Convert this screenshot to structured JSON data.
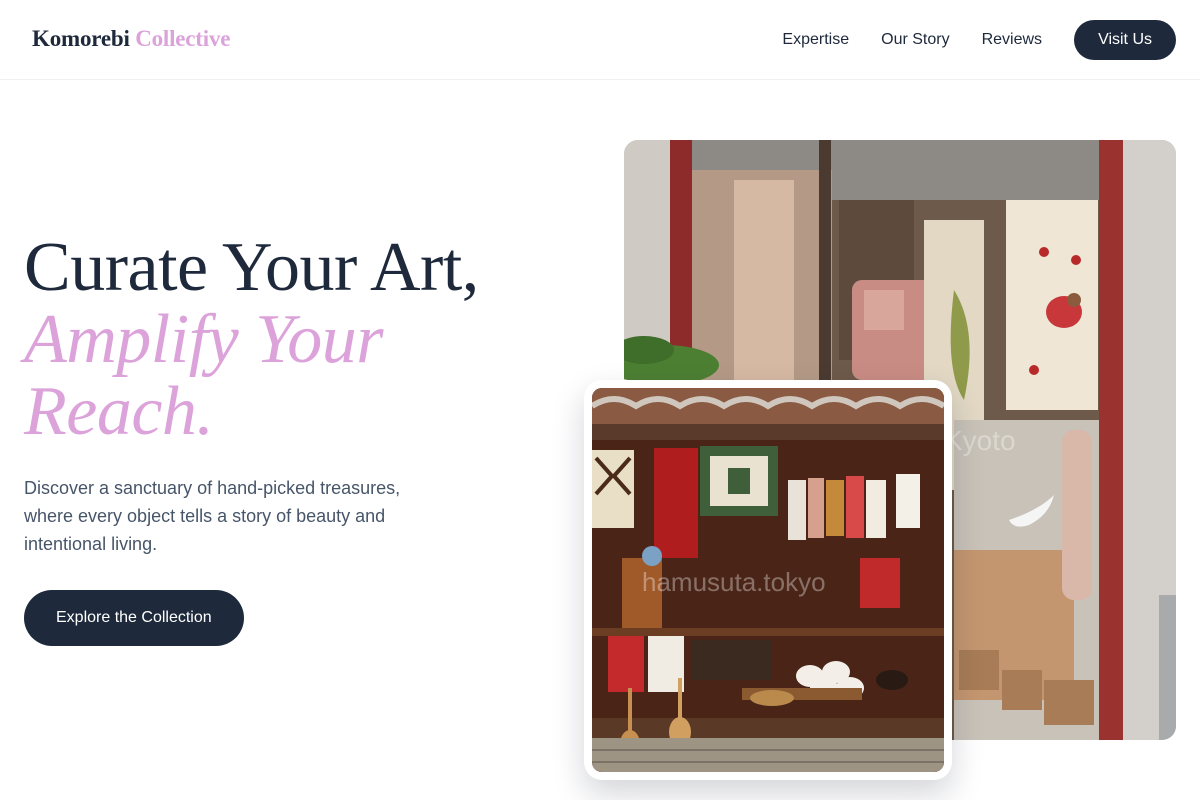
{
  "header": {
    "logo_main": "Komorebi",
    "logo_accent": "Collective",
    "nav": [
      {
        "label": "Expertise"
      },
      {
        "label": "Our Story"
      },
      {
        "label": "Reviews"
      }
    ],
    "cta_label": "Visit Us"
  },
  "hero": {
    "title_line1": "Curate Your Art,",
    "title_line2": "Amplify Your",
    "title_line3": "Reach.",
    "description": "Discover a sanctuary of hand-picked treasures, where every object tells a story of beauty and intentional living.",
    "cta_label": "Explore the Collection"
  },
  "images": {
    "shop_window_watermark": "Kyoto",
    "market_watermark": "hamusuta.tokyo"
  },
  "colors": {
    "primary": "#1e293b",
    "accent": "#dca3db",
    "body_text": "#475569"
  }
}
